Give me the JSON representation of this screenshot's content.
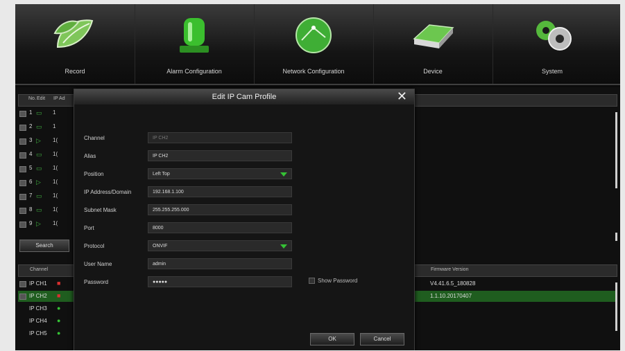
{
  "menu": [
    {
      "label": "Record",
      "icon": "leaves-icon"
    },
    {
      "label": "Alarm Configuration",
      "icon": "alarm-light-icon"
    },
    {
      "label": "Network Configuration",
      "icon": "network-globe-icon"
    },
    {
      "label": "Device",
      "icon": "hard-drive-icon"
    },
    {
      "label": "System",
      "icon": "gears-icon"
    }
  ],
  "camera_list": {
    "headers": {
      "no": "No.",
      "edit": "Edit",
      "ip": "IP Ad"
    },
    "rows": [
      {
        "no": "1",
        "ip": "1"
      },
      {
        "no": "2",
        "ip": "1"
      },
      {
        "no": "3",
        "ip": "1("
      },
      {
        "no": "4",
        "ip": "1("
      },
      {
        "no": "5",
        "ip": "1("
      },
      {
        "no": "6",
        "ip": "1("
      },
      {
        "no": "7",
        "ip": "1("
      },
      {
        "no": "8",
        "ip": "1("
      },
      {
        "no": "9",
        "ip": "1("
      }
    ],
    "search_label": "Search"
  },
  "channel_list": {
    "headers": {
      "channel": "Channel",
      "firmware": "Firmware Version"
    },
    "rows": [
      {
        "channel": "IP CH1",
        "status_color": "#d93030",
        "firmware": "V4.41.6.5_180828"
      },
      {
        "channel": "IP CH2",
        "status_color": "#d93030",
        "firmware": "1.1.10.20170407"
      },
      {
        "channel": "IP CH3",
        "status_color": "#35c235",
        "firmware": ""
      },
      {
        "channel": "IP CH4",
        "status_color": "#35c235",
        "firmware": ""
      },
      {
        "channel": "IP CH5",
        "status_color": "#35c235",
        "firmware": ""
      }
    ]
  },
  "dialog": {
    "title": "Edit IP Cam Profile",
    "fields": [
      {
        "label": "Channel",
        "value": "IP CH2"
      },
      {
        "label": "Alias",
        "value": "IP CH2"
      },
      {
        "label": "Position",
        "value": "Left Top"
      },
      {
        "label": "IP Address/Domain",
        "value": "192.168.1.100"
      },
      {
        "label": "Subnet Mask",
        "value": "255.255.255.000"
      },
      {
        "label": "Port",
        "value": "8000"
      },
      {
        "label": "Protocol",
        "value": "ONVIF"
      },
      {
        "label": "User Name",
        "value": "admin"
      },
      {
        "label": "Password",
        "value": "●●●●●"
      }
    ],
    "show_password_label": "Show Password",
    "ok_label": "OK",
    "cancel_label": "Cancel"
  }
}
